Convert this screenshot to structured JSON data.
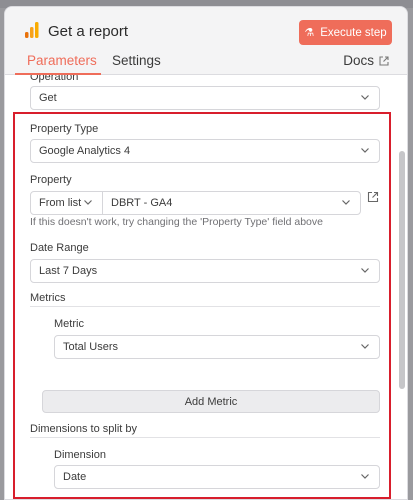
{
  "header": {
    "title": "Get a report",
    "node_icon": "analytics-bars-icon",
    "execute_button": "Execute step",
    "execute_icon": "flask-icon"
  },
  "tabs": {
    "parameters": "Parameters",
    "settings": "Settings",
    "docs": "Docs"
  },
  "colors": {
    "accent": "#ef6d5a",
    "highlight": "#d81e2c",
    "icon_orange": "#f7a21b"
  },
  "fields": {
    "operation": {
      "label": "Operation",
      "value": "Get"
    },
    "property_type": {
      "label": "Property Type",
      "value": "Google Analytics 4"
    },
    "property": {
      "label": "Property",
      "mode": "From list",
      "value": "DBRT - GA4",
      "hint": "If this doesn't work, try changing the 'Property Type' field above"
    },
    "date_range": {
      "label": "Date Range",
      "value": "Last 7 Days"
    },
    "metrics": {
      "section_label": "Metrics",
      "item_label": "Metric",
      "item_value": "Total Users",
      "add_button": "Add Metric"
    },
    "dimensions": {
      "section_label": "Dimensions to split by",
      "item_label": "Dimension",
      "item_value": "Date"
    }
  }
}
